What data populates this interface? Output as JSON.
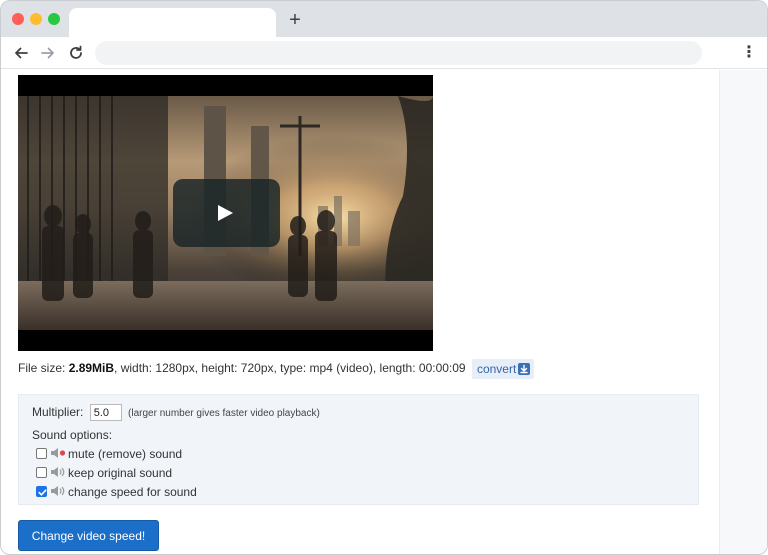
{
  "browser": {
    "new_tab_label": "+",
    "menu_label": "⋮"
  },
  "video": {
    "play_icon": "play-icon"
  },
  "file_info": {
    "prefix": "File size: ",
    "size": "2.89MiB",
    "details": ", width: 1280px, height: 720px, type: mp4 (video), length: 00:00:09",
    "convert_label": "convert"
  },
  "options": {
    "multiplier_label": "Multiplier:",
    "multiplier_value": "5.0",
    "multiplier_hint": "(larger number gives faster video playback)",
    "sound_options_label": "Sound options:",
    "sound_choices": [
      {
        "label": "mute (remove) sound",
        "checked": false,
        "icon": "muted-speaker-icon"
      },
      {
        "label": "keep original sound",
        "checked": false,
        "icon": "speaker-icon"
      },
      {
        "label": "change speed for sound",
        "checked": true,
        "icon": "speaker-icon"
      }
    ]
  },
  "submit_label": "Change video speed!",
  "colors": {
    "accent": "#1c6fc9",
    "panel": "#f1f5fa",
    "checkbox_checked": "#1a73e8"
  }
}
